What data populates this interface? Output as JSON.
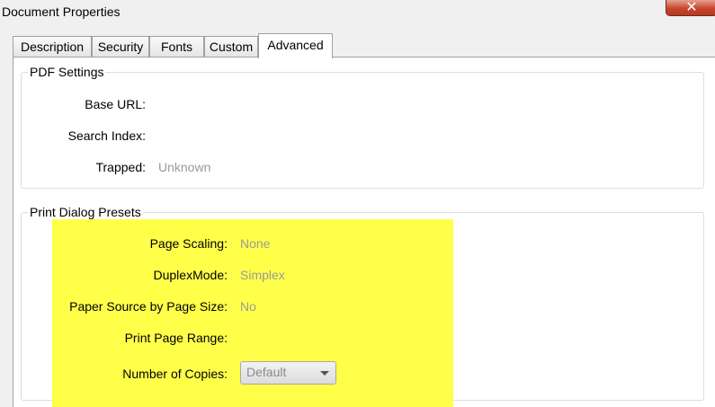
{
  "window": {
    "title": "Document Properties",
    "close_label": "✕"
  },
  "tabs": [
    {
      "label": "Description"
    },
    {
      "label": "Security"
    },
    {
      "label": "Fonts"
    },
    {
      "label": "Custom"
    },
    {
      "label": "Advanced",
      "active": true
    }
  ],
  "pdf_settings": {
    "legend": "PDF Settings",
    "base_url": {
      "label": "Base URL:",
      "value": ""
    },
    "search_index": {
      "label": "Search Index:",
      "value": ""
    },
    "trapped": {
      "label": "Trapped:",
      "value": "Unknown"
    }
  },
  "print_presets": {
    "legend": "Print Dialog Presets",
    "page_scaling": {
      "label": "Page Scaling:",
      "value": "None"
    },
    "duplex_mode": {
      "label": "DuplexMode:",
      "value": "Simplex"
    },
    "paper_source": {
      "label": "Paper Source by Page Size:",
      "value": "No"
    },
    "print_page_range": {
      "label": "Print Page Range:",
      "value": ""
    },
    "number_of_copies": {
      "label": "Number of Copies:",
      "selected": "Default"
    }
  },
  "colors": {
    "highlight": "#ffff4a",
    "disabled_text": "#9a9a9a"
  }
}
